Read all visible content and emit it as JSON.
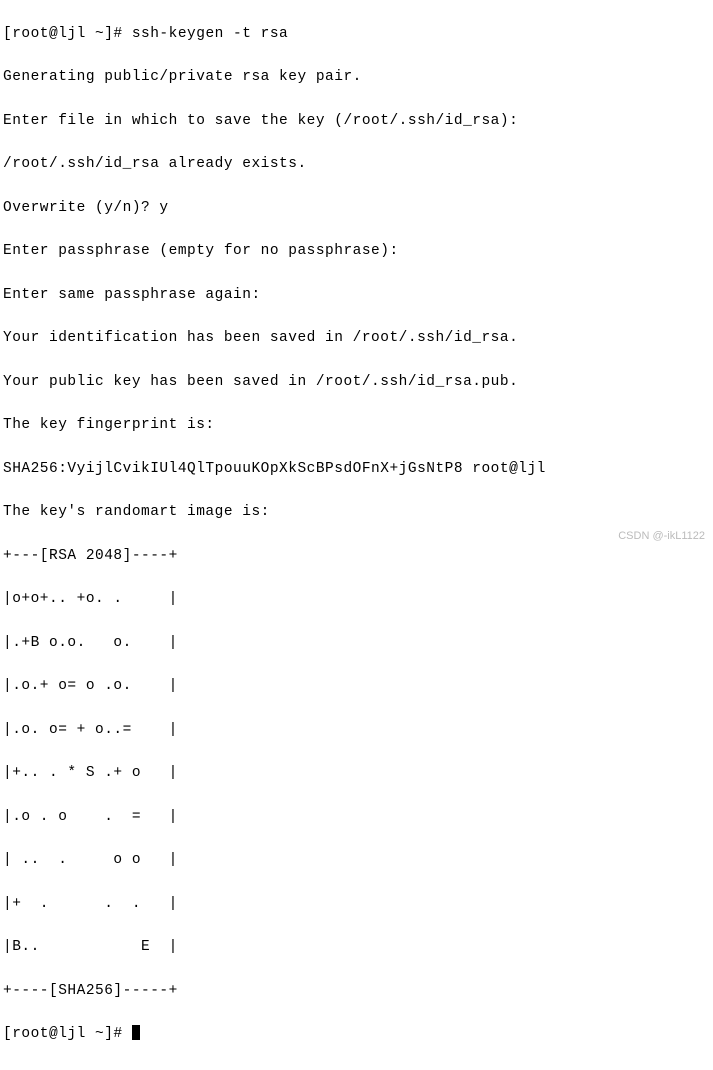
{
  "prompt1": {
    "prefix": "[root@ljl ~]# ",
    "command": "ssh-keygen -t rsa"
  },
  "lines": [
    "Generating public/private rsa key pair.",
    "Enter file in which to save the key (/root/.ssh/id_rsa):",
    "/root/.ssh/id_rsa already exists.",
    "Overwrite (y/n)? y",
    "Enter passphrase (empty for no passphrase):",
    "Enter same passphrase again:",
    "Your identification has been saved in /root/.ssh/id_rsa.",
    "Your public key has been saved in /root/.ssh/id_rsa.pub.",
    "The key fingerprint is:",
    "SHA256:VyijlCvikIUl4QlTpouuKOpXkScBPsdOFnX+jGsNtP8 root@ljl",
    "The key's randomart image is:",
    "+---[RSA 2048]----+",
    "|o+o+.. +o. .     |",
    "|.+B o.o.   o.    |",
    "|.o.+ o= o .o.    |",
    "|.o. o= + o..=    |",
    "|+.. . * S .+ o   |",
    "|.o . o    .  =   |",
    "| ..  .     o o   |",
    "|+  .      .  .   |",
    "|B..           E  |",
    "+----[SHA256]-----+"
  ],
  "prompt2": {
    "prefix": "[root@ljl ~]# "
  },
  "watermark": "CSDN @-ikL1122"
}
